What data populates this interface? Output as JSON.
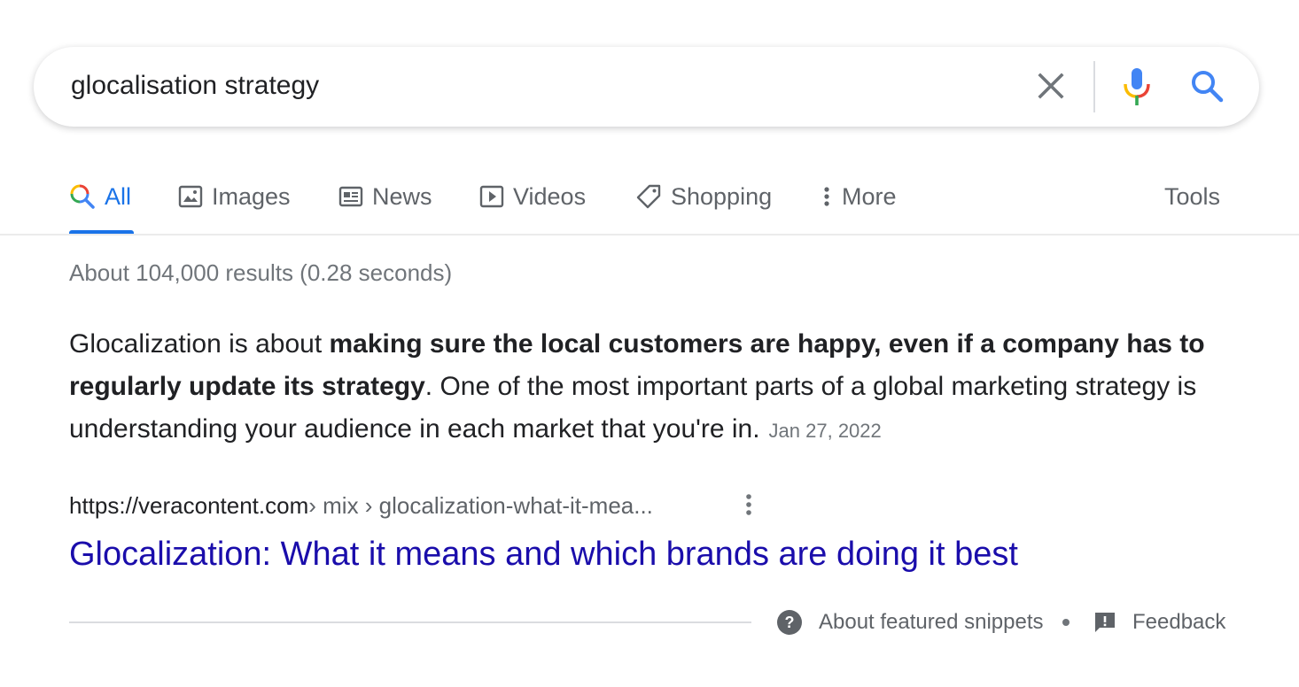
{
  "search": {
    "query": "glocalisation strategy",
    "icons": {
      "clear": "close-icon",
      "voice": "microphone-icon",
      "submit": "search-icon"
    }
  },
  "tabs": [
    {
      "label": "All",
      "icon": "search-icon",
      "active": true
    },
    {
      "label": "Images",
      "icon": "image-icon"
    },
    {
      "label": "News",
      "icon": "newspaper-icon"
    },
    {
      "label": "Videos",
      "icon": "play-icon"
    },
    {
      "label": "Shopping",
      "icon": "tag-icon"
    },
    {
      "label": "More",
      "icon": "more-vertical-icon"
    }
  ],
  "tools_label": "Tools",
  "result_stats": "About 104,000 results (0.28 seconds)",
  "featured_snippet": {
    "text_part1": "Glocalization is about ",
    "text_bold": "making sure the local customers are happy, even if a company has to regularly update its strategy",
    "text_part2": ". One of the most important parts of a global marketing strategy is understanding your audience in each market that you're in.",
    "date": "Jan 27, 2022",
    "cite_domain": "https://veracontent.com",
    "cite_path": " › mix › glocalization-what-it-mea...",
    "title": "Glocalization: What it means and which brands are doing it best"
  },
  "footer": {
    "about_label": "About featured snippets",
    "feedback_label": "Feedback"
  },
  "colors": {
    "accent": "#1a73e8",
    "link": "#1a0dab",
    "text": "#202124",
    "muted": "#70757a",
    "google_blue": "#4285f4",
    "google_red": "#ea4335",
    "google_yellow": "#fbbc04",
    "google_green": "#34a853"
  }
}
